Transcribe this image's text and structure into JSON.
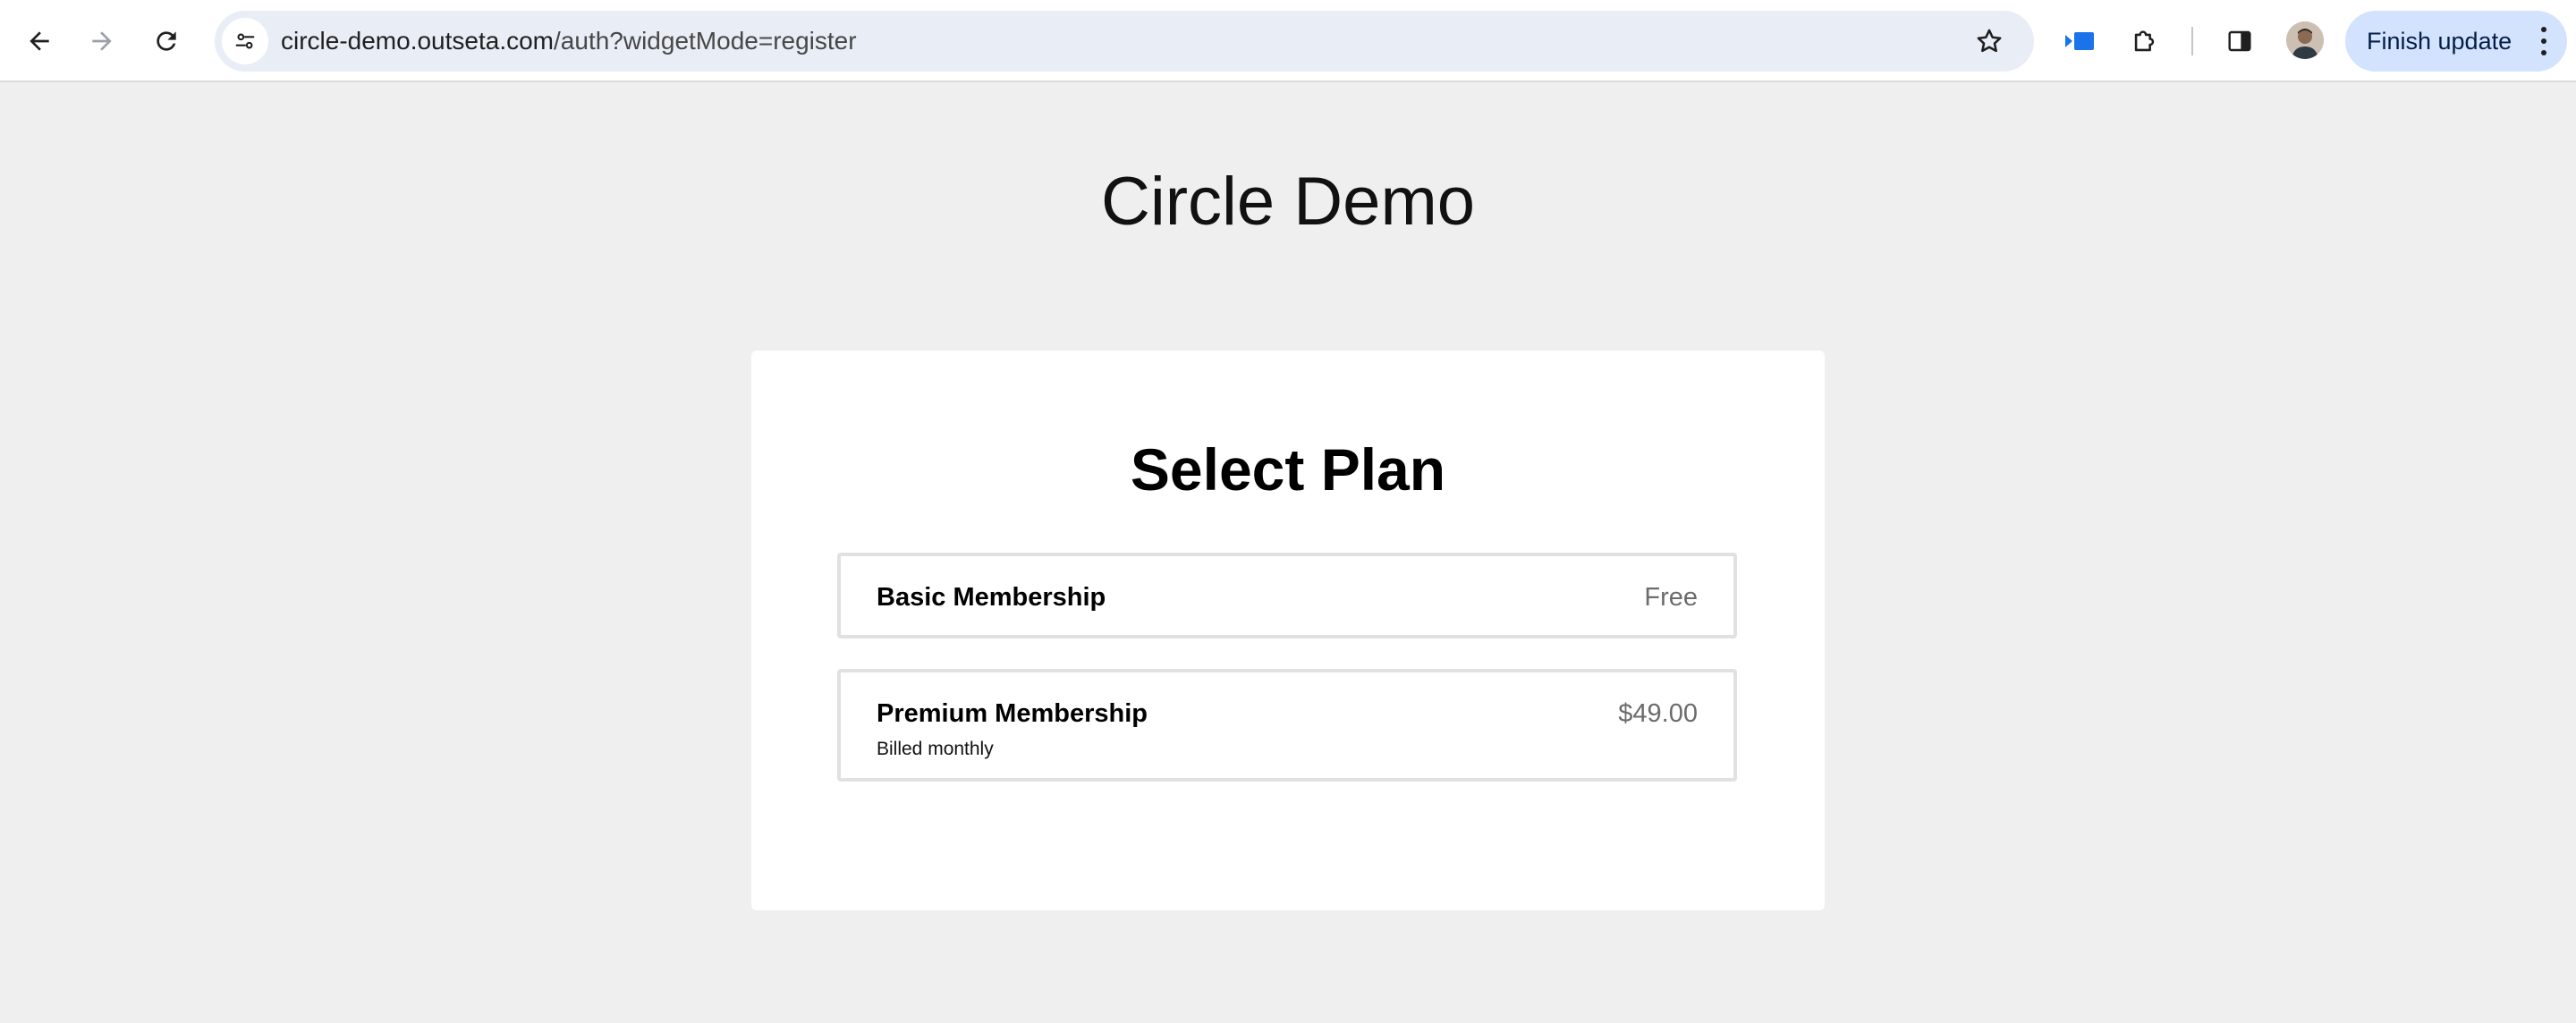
{
  "browser": {
    "url_host": "circle-demo.outseta.com",
    "url_path": "/auth?widgetMode=register",
    "update_button_label": "Finish update",
    "icons": {
      "back": "arrow-left-icon",
      "forward": "arrow-right-icon",
      "reload": "reload-icon",
      "site_info": "tune-icon",
      "bookmark": "star-icon",
      "extension_active": "screencast-extension-icon",
      "extensions": "puzzle-icon",
      "side_panel": "side-panel-icon",
      "profile": "avatar",
      "menu": "kebab-menu-icon"
    }
  },
  "page": {
    "site_title": "Circle Demo",
    "heading": "Select Plan"
  },
  "plans": [
    {
      "name": "Basic Membership",
      "price": "Free",
      "note": ""
    },
    {
      "name": "Premium Membership",
      "price": "$49.00",
      "note": "Billed monthly"
    }
  ],
  "colors": {
    "page_background": "#efefef",
    "card_background": "#ffffff",
    "omnibox_background": "#e9edf6",
    "update_chip": "#d3e3fd",
    "extension_accent": "#1a73e8",
    "plan_border": "#e1e1e1",
    "price_text": "#6b6b6b"
  }
}
